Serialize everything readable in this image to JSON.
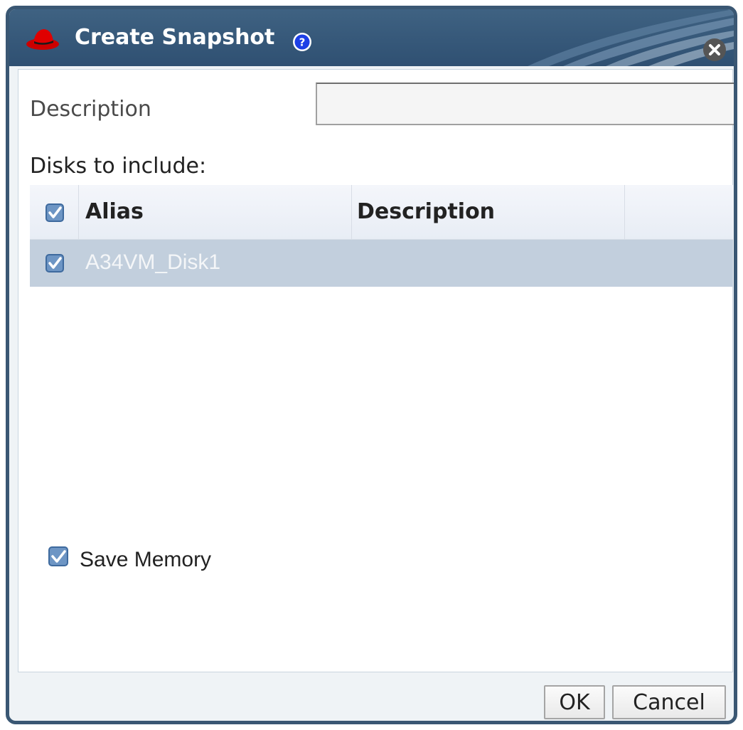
{
  "dialog": {
    "title": "Create Snapshot",
    "colors": {
      "titlebar": "#2f5072",
      "frame": "#3a5773",
      "selected_row": "#c2cfdd"
    }
  },
  "form": {
    "description_label": "Description",
    "description_value": "",
    "disks_label": "Disks to include:"
  },
  "disks_table": {
    "columns": [
      "Alias",
      "Description"
    ],
    "rows": [
      {
        "alias": "A34VM_Disk1",
        "description": "",
        "checked": true,
        "selected": true
      }
    ],
    "header_checked": true
  },
  "options": {
    "save_memory_label": "Save Memory",
    "save_memory_checked": true
  },
  "footer": {
    "ok_label": "OK",
    "cancel_label": "Cancel"
  }
}
